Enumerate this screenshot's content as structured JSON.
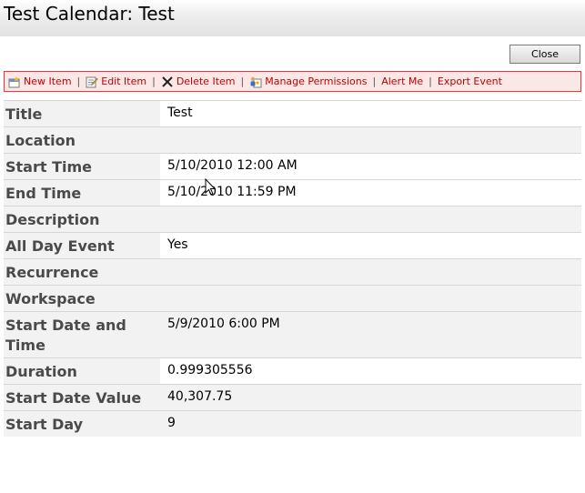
{
  "window": {
    "title": "Test Calendar: Test"
  },
  "close_label": "Close",
  "toolbar": {
    "items": [
      {
        "label": "New Item",
        "icon": "new-item-icon"
      },
      {
        "label": "Edit Item",
        "icon": "edit-item-icon"
      },
      {
        "label": "Delete Item",
        "icon": "delete-item-icon"
      },
      {
        "label": "Manage Permissions",
        "icon": "manage-permissions-icon"
      },
      {
        "label": "Alert Me"
      },
      {
        "label": "Export Event"
      }
    ],
    "separator": "|"
  },
  "fields": [
    {
      "label": "Title",
      "value": "Test"
    },
    {
      "label": "Location",
      "value": ""
    },
    {
      "label": "Start Time",
      "value": "5/10/2010 12:00 AM"
    },
    {
      "label": "End Time",
      "value": "5/10/2010 11:59 PM"
    },
    {
      "label": "Description",
      "value": ""
    },
    {
      "label": "All Day Event",
      "value": "Yes"
    },
    {
      "label": "Recurrence",
      "value": ""
    },
    {
      "label": "Workspace",
      "value": ""
    },
    {
      "label": "Start Date and Time",
      "value": "5/9/2010 6:00 PM"
    },
    {
      "label": "Duration",
      "value": "0.999305556"
    },
    {
      "label": "Start Date Value",
      "value": "40,307.75"
    },
    {
      "label": "Start Day",
      "value": "9"
    }
  ]
}
